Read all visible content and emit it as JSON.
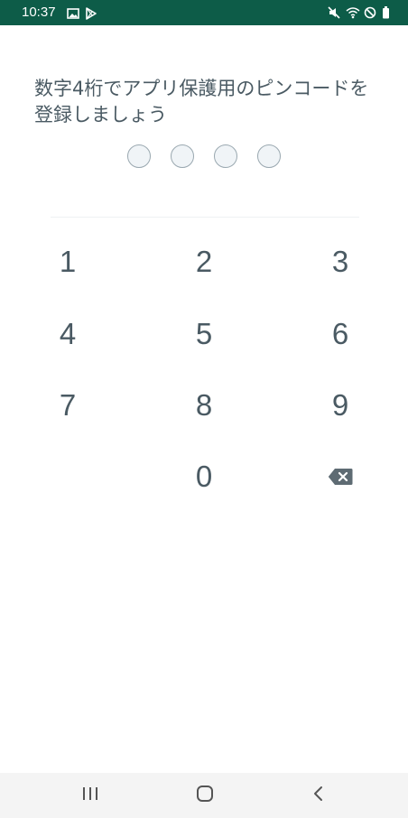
{
  "status_bar": {
    "time": "10:37",
    "left_icons": [
      "image-icon",
      "play-store-icon"
    ],
    "right_icons": [
      "mute-icon",
      "wifi-icon",
      "do-not-disturb-icon",
      "battery-icon"
    ],
    "background_color": "#0d5c48"
  },
  "prompt": {
    "text": "数字4桁でアプリ保護用のピンコードを登録しましょう"
  },
  "pin": {
    "length": 4,
    "entered": 0
  },
  "keypad": {
    "keys": [
      "1",
      "2",
      "3",
      "4",
      "5",
      "6",
      "7",
      "8",
      "9",
      "0"
    ],
    "backspace_icon": "backspace-icon"
  },
  "nav_bar": {
    "buttons": [
      "recent-apps-icon",
      "home-icon",
      "back-icon"
    ]
  },
  "colors": {
    "text": "#4a5a63",
    "dot_border": "#9aa8b0",
    "dot_fill": "#f0f4f7"
  }
}
